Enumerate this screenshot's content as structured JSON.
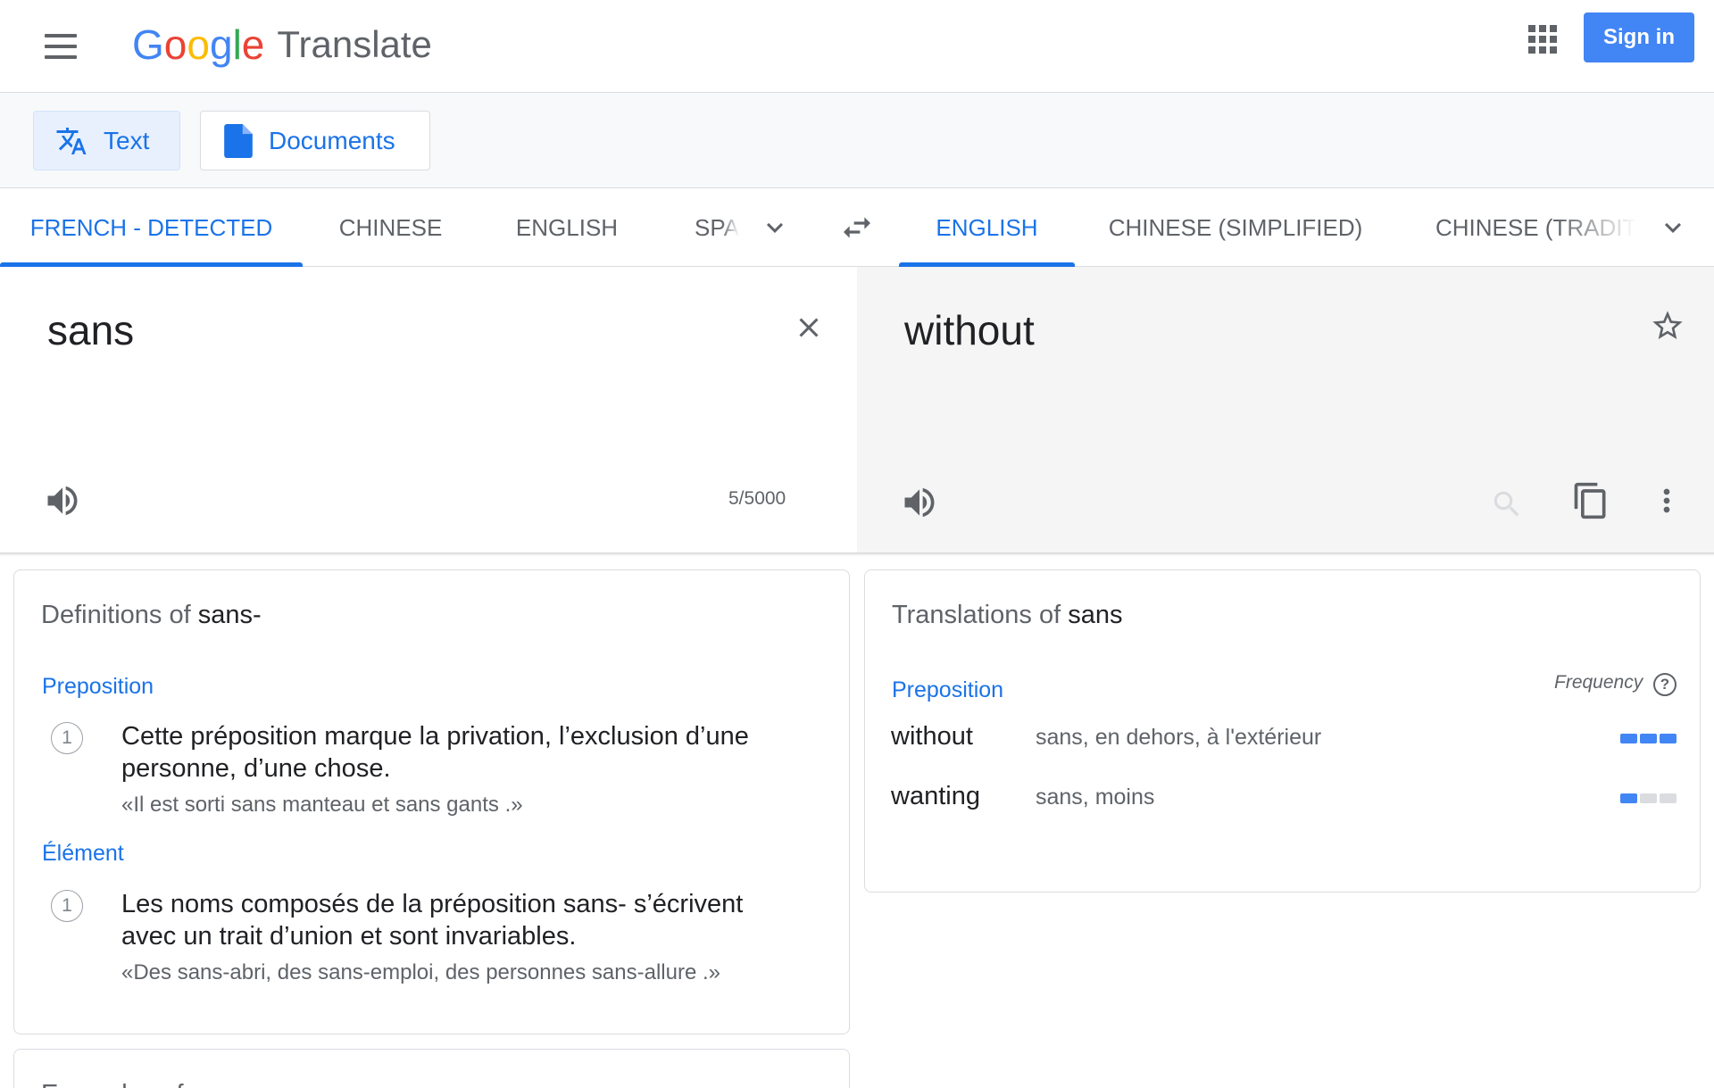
{
  "header": {
    "logo_letters": [
      "G",
      "o",
      "o",
      "g",
      "l",
      "e"
    ],
    "product_name": "Translate",
    "apps_icon": "apps-grid-icon",
    "menu_icon": "hamburger-menu-icon",
    "signin_label": "Sign in",
    "colors": {
      "blue": "#4285f4",
      "red": "#ea4335",
      "yellow": "#fbbc05",
      "green": "#34a853"
    }
  },
  "modes": {
    "text_label": "Text",
    "documents_label": "Documents",
    "active": "Text"
  },
  "source_languages": {
    "tabs": [
      "FRENCH - DETECTED",
      "CHINESE",
      "ENGLISH",
      "SPANISH"
    ],
    "active_index": 0
  },
  "target_languages": {
    "tabs": [
      "ENGLISH",
      "CHINESE (SIMPLIFIED)",
      "CHINESE (TRADITIONAL)"
    ],
    "active_index": 0
  },
  "source": {
    "text": "sans",
    "char_count": "5/5000"
  },
  "target": {
    "text": "without"
  },
  "definitions": {
    "title_prefix": "Definitions of",
    "title_word": "sans-",
    "groups": [
      {
        "pos": "Preposition",
        "entries": [
          {
            "number": "1",
            "gloss": "Cette préposition marque la privation, l’exclusion d’une personne, d’une chose.",
            "example": "«Il est sorti sans manteau et sans gants .»"
          }
        ]
      },
      {
        "pos": "Élément",
        "entries": [
          {
            "number": "1",
            "gloss": "Les noms composés de la préposition sans- s’écrivent avec un trait d’union et sont invariables.",
            "example": "«Des sans-abri, des sans-emploi, des personnes sans-allure .»"
          }
        ]
      }
    ]
  },
  "examples_card": {
    "title": "Examples of"
  },
  "translations": {
    "title_prefix": "Translations of",
    "title_word": "sans",
    "pos": "Preposition",
    "frequency_label": "Frequency",
    "rows": [
      {
        "word": "without",
        "reverse": "sans, en dehors, à l'extérieur",
        "frequency": 3
      },
      {
        "word": "wanting",
        "reverse": "sans, moins",
        "frequency": 1
      }
    ],
    "frequency_max": 3
  },
  "accent_colors": {
    "link_blue": "#1a73e8",
    "bar_blue": "#4285f4",
    "bar_off": "#dadce0",
    "target_bg": "#f5f5f5"
  }
}
